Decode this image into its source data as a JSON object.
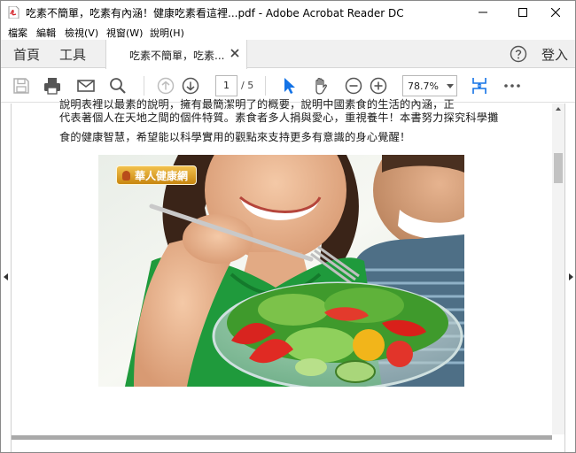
{
  "window": {
    "title": "吃素不簡單，吃素有內涵！健康吃素看這裡...pdf - Adobe Acrobat Reader DC"
  },
  "menu": {
    "items": [
      "檔案",
      "編輯",
      "檢視(V)",
      "視窗(W)",
      "說明(H)"
    ]
  },
  "tabs": {
    "home": "首頁",
    "tools": "工具",
    "document": "吃素不簡單，吃素...",
    "signin": "登入"
  },
  "toolbar": {
    "page_current": "1",
    "page_total": "/ 5",
    "zoom": "78.7%"
  },
  "document": {
    "line_cut": "說明表裡以最素的說明，擁有最簡潔明了的概要，說明中國素食的生活的內涵，正",
    "line_1": "代表著個人在天地之間的個件特質。素食者多人捐與愛心，重視養牛！本書努力探究科學攤",
    "line_2": "食的健康智慧，希望能以科學實用的觀點來支持更多有意識的身心覺醒！",
    "photo_logo": "華人健康網"
  },
  "colors": {
    "accent": "#1473e6",
    "window_border": "#8a8a8a",
    "tabbar_bg": "#f0f0f0"
  }
}
